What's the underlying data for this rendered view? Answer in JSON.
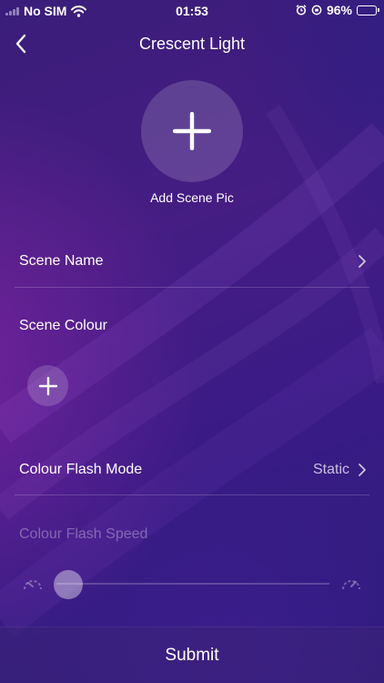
{
  "status_bar": {
    "carrier": "No SIM",
    "time": "01:53",
    "battery": "96%"
  },
  "nav": {
    "title": "Crescent Light",
    "back_icon": "chevron-left-icon"
  },
  "scene_pic": {
    "label": "Add Scene Pic",
    "icon": "plus-icon"
  },
  "scene_name": {
    "label": "Scene Name",
    "icon": "chevron-right-icon"
  },
  "scene_colour": {
    "label": "Scene Colour",
    "add_icon": "plus-icon"
  },
  "flash_mode": {
    "label": "Colour Flash Mode",
    "value": "Static",
    "icon": "chevron-right-icon"
  },
  "flash_speed": {
    "label": "Colour Flash Speed",
    "value": 0,
    "slow_icon": "speedometer-slow-icon",
    "fast_icon": "speedometer-fast-icon"
  },
  "submit": {
    "label": "Submit"
  },
  "colors": {
    "battery_fill": "#4cd964",
    "background_top": "#3a1d7a",
    "background_bottom": "#2b1c7d"
  }
}
